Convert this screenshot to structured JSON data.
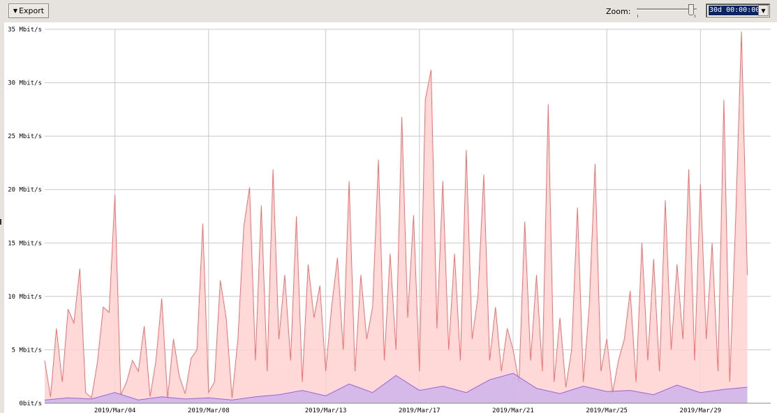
{
  "toolbar": {
    "export_label": "Export",
    "zoom_label": "Zoom:",
    "zoom_value": "30d 00:00:00"
  },
  "colors": {
    "total_line": "#f46e6e",
    "total_fill": "#ffd4d4",
    "secondary_line": "#9a63d8",
    "secondary_fill": "#cbb2ee",
    "grid": "#c8c8c8"
  },
  "chart_data": {
    "type": "area",
    "yunit": "Mbit/s",
    "ylim": [
      0,
      35
    ],
    "y_ticks": [
      {
        "value": 0,
        "label": "0bit/s"
      },
      {
        "value": 5,
        "label": "5 Mbit/s"
      },
      {
        "value": 10,
        "label": "10 Mbit/s"
      },
      {
        "value": 15,
        "label": "15 Mbit/s"
      },
      {
        "value": 20,
        "label": "20 Mbit/s"
      },
      {
        "value": 25,
        "label": "25 Mbit/s"
      },
      {
        "value": 30,
        "label": "30 Mbit/s"
      },
      {
        "value": 35,
        "label": "35 Mbit/s"
      }
    ],
    "xlim": [
      "2019-03-01",
      "2019-04-01"
    ],
    "x_ticks": [
      {
        "value": "2019-03-04",
        "label": "2019/Mar/04"
      },
      {
        "value": "2019-03-08",
        "label": "2019/Mar/08"
      },
      {
        "value": "2019-03-13",
        "label": "2019/Mar/13"
      },
      {
        "value": "2019-03-17",
        "label": "2019/Mar/17"
      },
      {
        "value": "2019-03-21",
        "label": "2019/Mar/21"
      },
      {
        "value": "2019-03-25",
        "label": "2019/Mar/25"
      },
      {
        "value": "2019-03-29",
        "label": "2019/Mar/29"
      }
    ],
    "grid": true,
    "series": [
      {
        "role": "total",
        "points": [
          [
            "2019-03-01",
            4.0
          ],
          [
            "2019-03-01T06:00",
            0.6
          ],
          [
            "2019-03-01T12:00",
            7.0
          ],
          [
            "2019-03-01T18:00",
            2.0
          ],
          [
            "2019-03-02",
            8.8
          ],
          [
            "2019-03-02T06:00",
            7.5
          ],
          [
            "2019-03-02T12:00",
            12.6
          ],
          [
            "2019-03-02T18:00",
            1.0
          ],
          [
            "2019-03-03",
            0.5
          ],
          [
            "2019-03-03T06:00",
            3.8
          ],
          [
            "2019-03-03T12:00",
            9.0
          ],
          [
            "2019-03-03T18:00",
            8.5
          ],
          [
            "2019-03-04",
            19.5
          ],
          [
            "2019-03-04T06:00",
            0.8
          ],
          [
            "2019-03-04T12:00",
            2.0
          ],
          [
            "2019-03-04T18:00",
            4.0
          ],
          [
            "2019-03-05",
            3.0
          ],
          [
            "2019-03-05T06:00",
            7.2
          ],
          [
            "2019-03-05T12:00",
            0.6
          ],
          [
            "2019-03-05T18:00",
            4.0
          ],
          [
            "2019-03-06",
            9.8
          ],
          [
            "2019-03-06T06:00",
            0.5
          ],
          [
            "2019-03-06T12:00",
            6.0
          ],
          [
            "2019-03-06T18:00",
            2.5
          ],
          [
            "2019-03-07",
            0.9
          ],
          [
            "2019-03-07T06:00",
            4.2
          ],
          [
            "2019-03-07T12:00",
            5.0
          ],
          [
            "2019-03-07T18:00",
            16.8
          ],
          [
            "2019-03-08",
            1.0
          ],
          [
            "2019-03-08T06:00",
            2.0
          ],
          [
            "2019-03-08T12:00",
            11.5
          ],
          [
            "2019-03-08T18:00",
            8.0
          ],
          [
            "2019-03-09",
            0.5
          ],
          [
            "2019-03-09T06:00",
            6.0
          ],
          [
            "2019-03-09T12:00",
            16.5
          ],
          [
            "2019-03-09T18:00",
            20.2
          ],
          [
            "2019-03-10",
            4.0
          ],
          [
            "2019-03-10T06:00",
            18.5
          ],
          [
            "2019-03-10T12:00",
            3.0
          ],
          [
            "2019-03-10T18:00",
            21.9
          ],
          [
            "2019-03-11",
            6.0
          ],
          [
            "2019-03-11T06:00",
            12.0
          ],
          [
            "2019-03-11T12:00",
            4.0
          ],
          [
            "2019-03-11T18:00",
            17.5
          ],
          [
            "2019-03-12",
            2.0
          ],
          [
            "2019-03-12T06:00",
            13.0
          ],
          [
            "2019-03-12T12:00",
            8.0
          ],
          [
            "2019-03-12T18:00",
            11.0
          ],
          [
            "2019-03-13",
            3.0
          ],
          [
            "2019-03-13T06:00",
            9.0
          ],
          [
            "2019-03-13T12:00",
            13.6
          ],
          [
            "2019-03-13T18:00",
            5.0
          ],
          [
            "2019-03-14",
            20.8
          ],
          [
            "2019-03-14T06:00",
            3.0
          ],
          [
            "2019-03-14T12:00",
            12.0
          ],
          [
            "2019-03-14T18:00",
            6.0
          ],
          [
            "2019-03-15",
            9.0
          ],
          [
            "2019-03-15T06:00",
            22.8
          ],
          [
            "2019-03-15T12:00",
            4.0
          ],
          [
            "2019-03-15T18:00",
            14.0
          ],
          [
            "2019-03-16",
            5.0
          ],
          [
            "2019-03-16T06:00",
            26.8
          ],
          [
            "2019-03-16T12:00",
            8.0
          ],
          [
            "2019-03-16T18:00",
            17.6
          ],
          [
            "2019-03-17",
            3.0
          ],
          [
            "2019-03-17T06:00",
            28.4
          ],
          [
            "2019-03-17T12:00",
            31.2
          ],
          [
            "2019-03-17T18:00",
            7.0
          ],
          [
            "2019-03-18",
            20.8
          ],
          [
            "2019-03-18T06:00",
            5.0
          ],
          [
            "2019-03-18T12:00",
            14.0
          ],
          [
            "2019-03-18T18:00",
            4.0
          ],
          [
            "2019-03-19",
            23.7
          ],
          [
            "2019-03-19T06:00",
            6.0
          ],
          [
            "2019-03-19T12:00",
            10.0
          ],
          [
            "2019-03-19T18:00",
            21.4
          ],
          [
            "2019-03-20",
            4.0
          ],
          [
            "2019-03-20T06:00",
            9.0
          ],
          [
            "2019-03-20T12:00",
            3.0
          ],
          [
            "2019-03-20T18:00",
            7.0
          ],
          [
            "2019-03-21",
            5.0
          ],
          [
            "2019-03-21T06:00",
            2.0
          ],
          [
            "2019-03-21T12:00",
            17.0
          ],
          [
            "2019-03-21T18:00",
            4.0
          ],
          [
            "2019-03-22",
            12.0
          ],
          [
            "2019-03-22T06:00",
            3.0
          ],
          [
            "2019-03-22T12:00",
            28.0
          ],
          [
            "2019-03-22T18:00",
            2.0
          ],
          [
            "2019-03-23",
            8.0
          ],
          [
            "2019-03-23T06:00",
            1.5
          ],
          [
            "2019-03-23T12:00",
            5.0
          ],
          [
            "2019-03-23T18:00",
            18.3
          ],
          [
            "2019-03-24",
            2.0
          ],
          [
            "2019-03-24T06:00",
            9.0
          ],
          [
            "2019-03-24T12:00",
            22.4
          ],
          [
            "2019-03-24T18:00",
            3.0
          ],
          [
            "2019-03-25",
            6.0
          ],
          [
            "2019-03-25T06:00",
            1.0
          ],
          [
            "2019-03-25T12:00",
            4.0
          ],
          [
            "2019-03-25T18:00",
            6.0
          ],
          [
            "2019-03-26",
            10.5
          ],
          [
            "2019-03-26T06:00",
            2.0
          ],
          [
            "2019-03-26T12:00",
            15.0
          ],
          [
            "2019-03-26T18:00",
            4.0
          ],
          [
            "2019-03-27",
            13.5
          ],
          [
            "2019-03-27T06:00",
            3.0
          ],
          [
            "2019-03-27T12:00",
            19.0
          ],
          [
            "2019-03-27T18:00",
            5.0
          ],
          [
            "2019-03-28",
            13.0
          ],
          [
            "2019-03-28T06:00",
            6.0
          ],
          [
            "2019-03-28T12:00",
            21.9
          ],
          [
            "2019-03-28T18:00",
            4.0
          ],
          [
            "2019-03-29",
            20.5
          ],
          [
            "2019-03-29T06:00",
            6.0
          ],
          [
            "2019-03-29T12:00",
            15.0
          ],
          [
            "2019-03-29T18:00",
            3.0
          ],
          [
            "2019-03-30",
            28.4
          ],
          [
            "2019-03-30T06:00",
            2.0
          ],
          [
            "2019-03-30T12:00",
            17.0
          ],
          [
            "2019-03-30T18:00",
            34.8
          ],
          [
            "2019-03-31",
            12.0
          ]
        ]
      },
      {
        "role": "secondary",
        "points": [
          [
            "2019-03-01",
            0.3
          ],
          [
            "2019-03-02",
            0.5
          ],
          [
            "2019-03-03",
            0.4
          ],
          [
            "2019-03-04",
            1.0
          ],
          [
            "2019-03-05",
            0.3
          ],
          [
            "2019-03-06",
            0.6
          ],
          [
            "2019-03-07",
            0.4
          ],
          [
            "2019-03-08",
            0.5
          ],
          [
            "2019-03-09",
            0.3
          ],
          [
            "2019-03-10",
            0.6
          ],
          [
            "2019-03-11",
            0.8
          ],
          [
            "2019-03-12",
            1.2
          ],
          [
            "2019-03-13",
            0.7
          ],
          [
            "2019-03-14",
            1.8
          ],
          [
            "2019-03-15",
            1.0
          ],
          [
            "2019-03-16",
            2.6
          ],
          [
            "2019-03-17",
            1.2
          ],
          [
            "2019-03-18",
            1.6
          ],
          [
            "2019-03-19",
            1.0
          ],
          [
            "2019-03-20",
            2.2
          ],
          [
            "2019-03-21",
            2.8
          ],
          [
            "2019-03-22",
            1.4
          ],
          [
            "2019-03-23",
            0.9
          ],
          [
            "2019-03-24",
            1.6
          ],
          [
            "2019-03-25",
            1.1
          ],
          [
            "2019-03-26",
            1.2
          ],
          [
            "2019-03-27",
            0.8
          ],
          [
            "2019-03-28",
            1.7
          ],
          [
            "2019-03-29",
            1.0
          ],
          [
            "2019-03-30",
            1.3
          ],
          [
            "2019-03-31",
            1.5
          ]
        ]
      }
    ]
  }
}
